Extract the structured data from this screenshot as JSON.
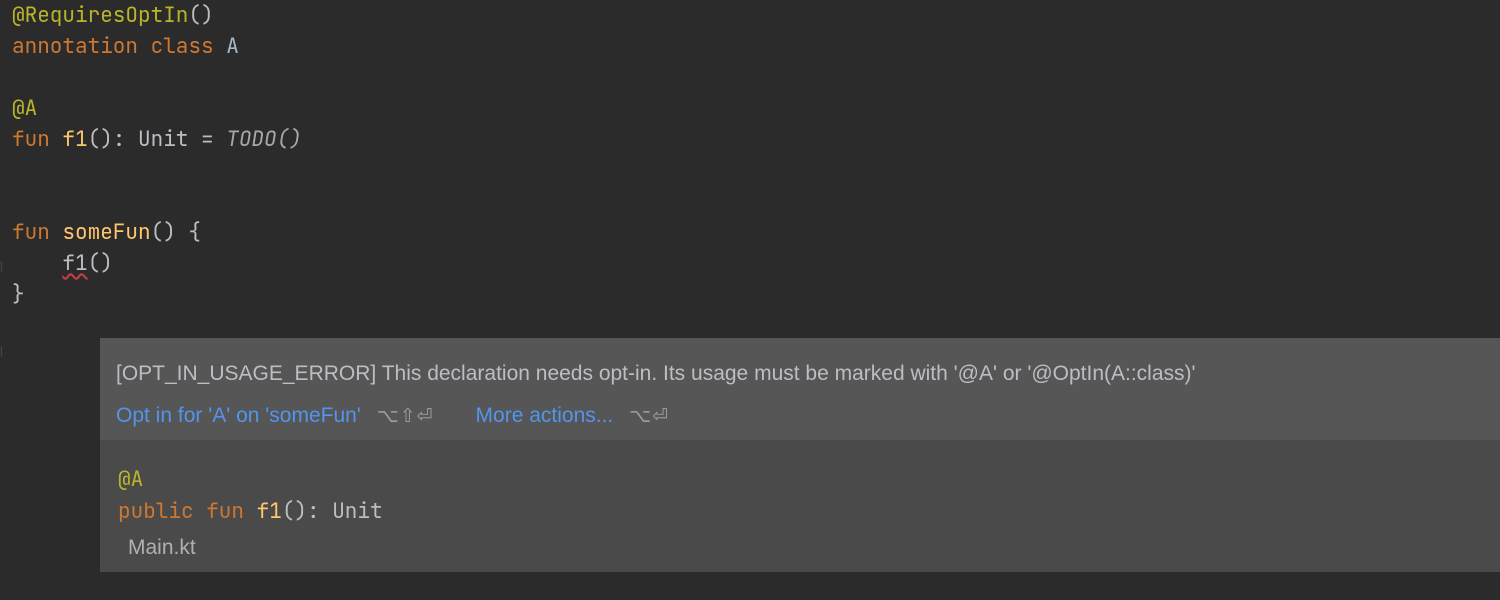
{
  "code": {
    "l1_anno": "@RequiresOptIn",
    "l1_par": "()",
    "l2_kw1": "annotation",
    "l2_kw2": " class ",
    "l2_name": "A",
    "l4_anno": "@A",
    "l5_kw": "fun ",
    "l5_fn": "f1",
    "l5_mid": "(): Unit = ",
    "l5_todo": "TODO()",
    "l7_kw": "fun ",
    "l7_fn": "someFun",
    "l7_tail": "() {",
    "l8_indent": "    ",
    "l8_call": "f1",
    "l8_tail": "()",
    "l9": "}"
  },
  "popup": {
    "message": "[OPT_IN_USAGE_ERROR] This declaration needs opt-in. Its usage must be marked with '@A' or '@OptIn(A::class)'",
    "fix_label": "Opt in for 'A' on 'someFun'",
    "fix_shortcut": "⌥⇧⏎",
    "more_label": "More actions...",
    "more_shortcut": "⌥⏎",
    "info_anno": "@A",
    "info_kw1": "public",
    "info_kw2": " fun ",
    "info_fn": "f1",
    "info_tail": "(): Unit",
    "file": "Main.kt"
  }
}
